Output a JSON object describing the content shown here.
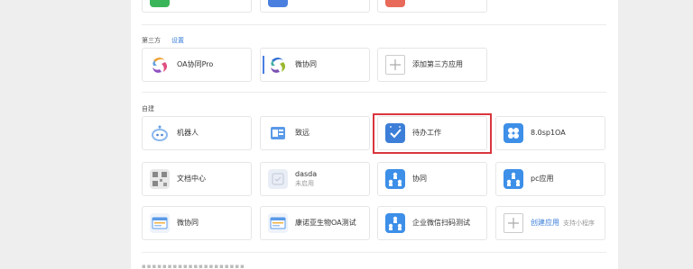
{
  "sections": {
    "third_party": {
      "label": "第三方",
      "settings_link": "设置"
    },
    "custom": {
      "label": "自建"
    }
  },
  "third_party_apps": [
    {
      "name": "OA协同Pro",
      "icon": "seeyon-logo-icon"
    },
    {
      "name": "微协同",
      "icon": "seeyon-logo-icon"
    },
    {
      "name": "添加第三方应用",
      "icon": "plus-icon"
    }
  ],
  "custom_apps": [
    {
      "name": "机器人",
      "icon": "robot-icon"
    },
    {
      "name": "致远",
      "icon": "app-icon"
    },
    {
      "name": "待办工作",
      "icon": "checkmark-icon"
    },
    {
      "name": "8.0sp1OA",
      "icon": "flower-icon"
    },
    {
      "name": "文档中心",
      "icon": "qr-doc-icon"
    },
    {
      "name": "dasda",
      "subtitle": "未启用",
      "icon": "app-placeholder-icon"
    },
    {
      "name": "协同",
      "icon": "org-chart-icon"
    },
    {
      "name": "pc应用",
      "icon": "org-chart-icon"
    },
    {
      "name": "微协同",
      "icon": "window-icon"
    },
    {
      "name": "康诺亚生物OA测试",
      "icon": "window-icon"
    },
    {
      "name": "企业微信扫码测试",
      "icon": "org-chart-icon"
    },
    {
      "name": "创建应用",
      "hint": "支持小程序",
      "icon": "plus-icon"
    }
  ],
  "colors": {
    "accent_blue": "#3d7fd8",
    "highlight_red": "#d9363e",
    "icon_blue": "#4a90e2",
    "top_green": "#3bb55a",
    "top_blue": "#4a7fe0",
    "top_red": "#e86a5a"
  }
}
